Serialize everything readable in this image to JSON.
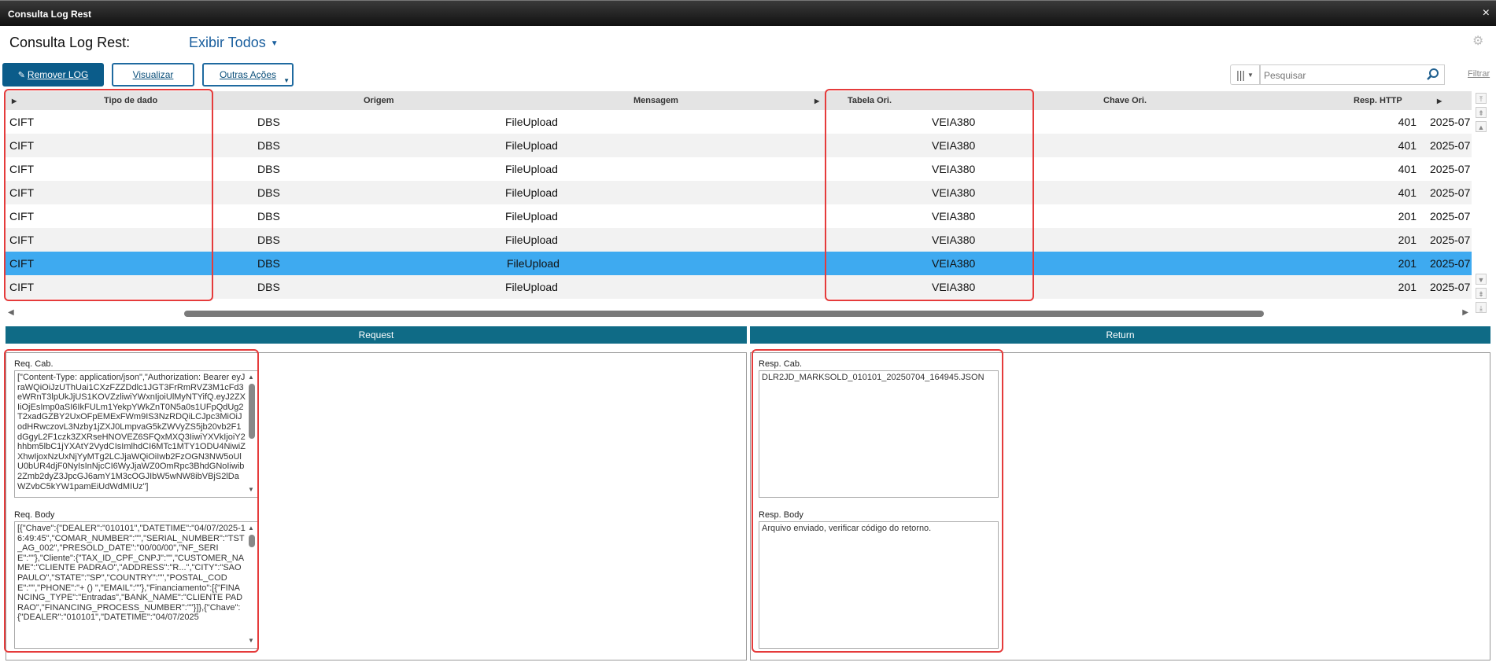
{
  "window": {
    "title": "Consulta Log Rest",
    "close_glyph": "×"
  },
  "header": {
    "title": "Consulta Log Rest:",
    "view_label": "Exibir Todos"
  },
  "toolbar": {
    "remove_label": "Remover LOG",
    "visualizar_label": "Visualizar",
    "outras_label": "Outras Ações",
    "search_placeholder": "Pesquisar",
    "filter_label": "Filtrar"
  },
  "grid": {
    "columns": [
      "Tipo de dado",
      "Origem",
      "Mensagem",
      "Tabela Ori.",
      "Chave Ori.",
      "Resp. HTTP"
    ],
    "rows": [
      {
        "tipo": "CIFT",
        "origem": "DBS",
        "mensagem": "FileUpload",
        "tabela": "VEIA380",
        "http": "401",
        "data": "2025-07"
      },
      {
        "tipo": "CIFT",
        "origem": "DBS",
        "mensagem": "FileUpload",
        "tabela": "VEIA380",
        "http": "401",
        "data": "2025-07"
      },
      {
        "tipo": "CIFT",
        "origem": "DBS",
        "mensagem": "FileUpload",
        "tabela": "VEIA380",
        "http": "401",
        "data": "2025-07"
      },
      {
        "tipo": "CIFT",
        "origem": "DBS",
        "mensagem": "FileUpload",
        "tabela": "VEIA380",
        "http": "401",
        "data": "2025-07"
      },
      {
        "tipo": "CIFT",
        "origem": "DBS",
        "mensagem": "FileUpload",
        "tabela": "VEIA380",
        "http": "201",
        "data": "2025-07"
      },
      {
        "tipo": "CIFT",
        "origem": "DBS",
        "mensagem": "FileUpload",
        "tabela": "VEIA380",
        "http": "201",
        "data": "2025-07"
      },
      {
        "tipo": "CIFT",
        "origem": "DBS",
        "mensagem": "FileUpload",
        "tabela": "VEIA380",
        "http": "201",
        "data": "2025-07"
      },
      {
        "tipo": "CIFT",
        "origem": "DBS",
        "mensagem": "FileUpload",
        "tabela": "VEIA380",
        "http": "201",
        "data": "2025-07"
      }
    ],
    "selected_row": 6
  },
  "request": {
    "header": "Request",
    "cab_label": "Req. Cab.",
    "cab_value": "[\"Content-Type: application/json\",\"Authorization: Bearer eyJraWQiOiJzUThUai1CXzFZZDdlc1JGT3FrRmRVZ3M1cFd3eWRnT3lpUkJjUS1KOVZzliwiYWxnIjoiUlMyNTYifQ.eyJ2ZXIiOjEsImp0aSI6IkFULm1YekpYWkZnT0N5a0s1UFpQdUg2T2xadGZBY2UxOFpEMExFWm9IS3NzRDQiLCJpc3MiOiJodHRwczovL3Nzby1jZXJ0LmpvaG5kZWVyZS5jb20vb2F1dGgyL2F1czk3ZXRseHNOVEZ6SFQxMXQ3IiwiYXVkIjoiY2hhbm5lbC1jYXAtY2VydCIsImlhdCI6MTc1MTY1ODU4NiwiZXhwIjoxNzUxNjYyMTg2LCJjaWQiOiIwb2FzOGN3NW5oUlU0bUR4djF0NyIsInNjcCI6WyJjaWZ0OmRpc3BhdGNoIiwib2Zmb2dyZ3JpcGJ6amY1M3cOGJIbW5wNW8ibVBjS2lDaWZvbC5kYW1pamEiUdWdMIUz\"]",
    "body_label": "Req. Body",
    "body_value": "[{\"Chave\":{\"DEALER\":\"010101\",\"DATETIME\":\"04/07/2025-16:49:45\",\"COMAR_NUMBER\":\"\",\"SERIAL_NUMBER\":\"TST_AG_002\",\"PRESOLD_DATE\":\"00/00/00\",\"NF_SERIE\":\"\"},\"Cliente\":{\"TAX_ID_CPF_CNPJ\":\"\",\"CUSTOMER_NAME\":\"CLIENTE PADRAO\",\"ADDRESS\":\"R...\",\"CITY\":\"SAO PAULO\",\"STATE\":\"SP\",\"COUNTRY\":\"\",\"POSTAL_CODE\":\"\",\"PHONE\":\"+ () \",\"EMAIL\":\"\"},\"Financiamento\":[{\"FINANCING_TYPE\":\"Entradas\",\"BANK_NAME\":\"CLIENTE PADRAO\",\"FINANCING_PROCESS_NUMBER\":\"\"}]},{\"Chave\":{\"DEALER\":\"010101\",\"DATETIME\":\"04/07/2025"
  },
  "return": {
    "header": "Return",
    "cab_label": "Resp. Cab.",
    "cab_value": "DLR2JD_MARKSOLD_010101_20250704_164945.JSON",
    "body_label": "Resp. Body",
    "body_value": "Arquivo enviado, verificar código do retorno."
  },
  "icons": {
    "gear": "gear-icon",
    "search": "search-icon",
    "columns": "columns-icon",
    "pencil": "pencil-icon"
  },
  "colors": {
    "accent": "#0b5c8a",
    "panel_header": "#0f6b86",
    "selected_row": "#3eaaf0",
    "highlight": "#e53b3b"
  }
}
